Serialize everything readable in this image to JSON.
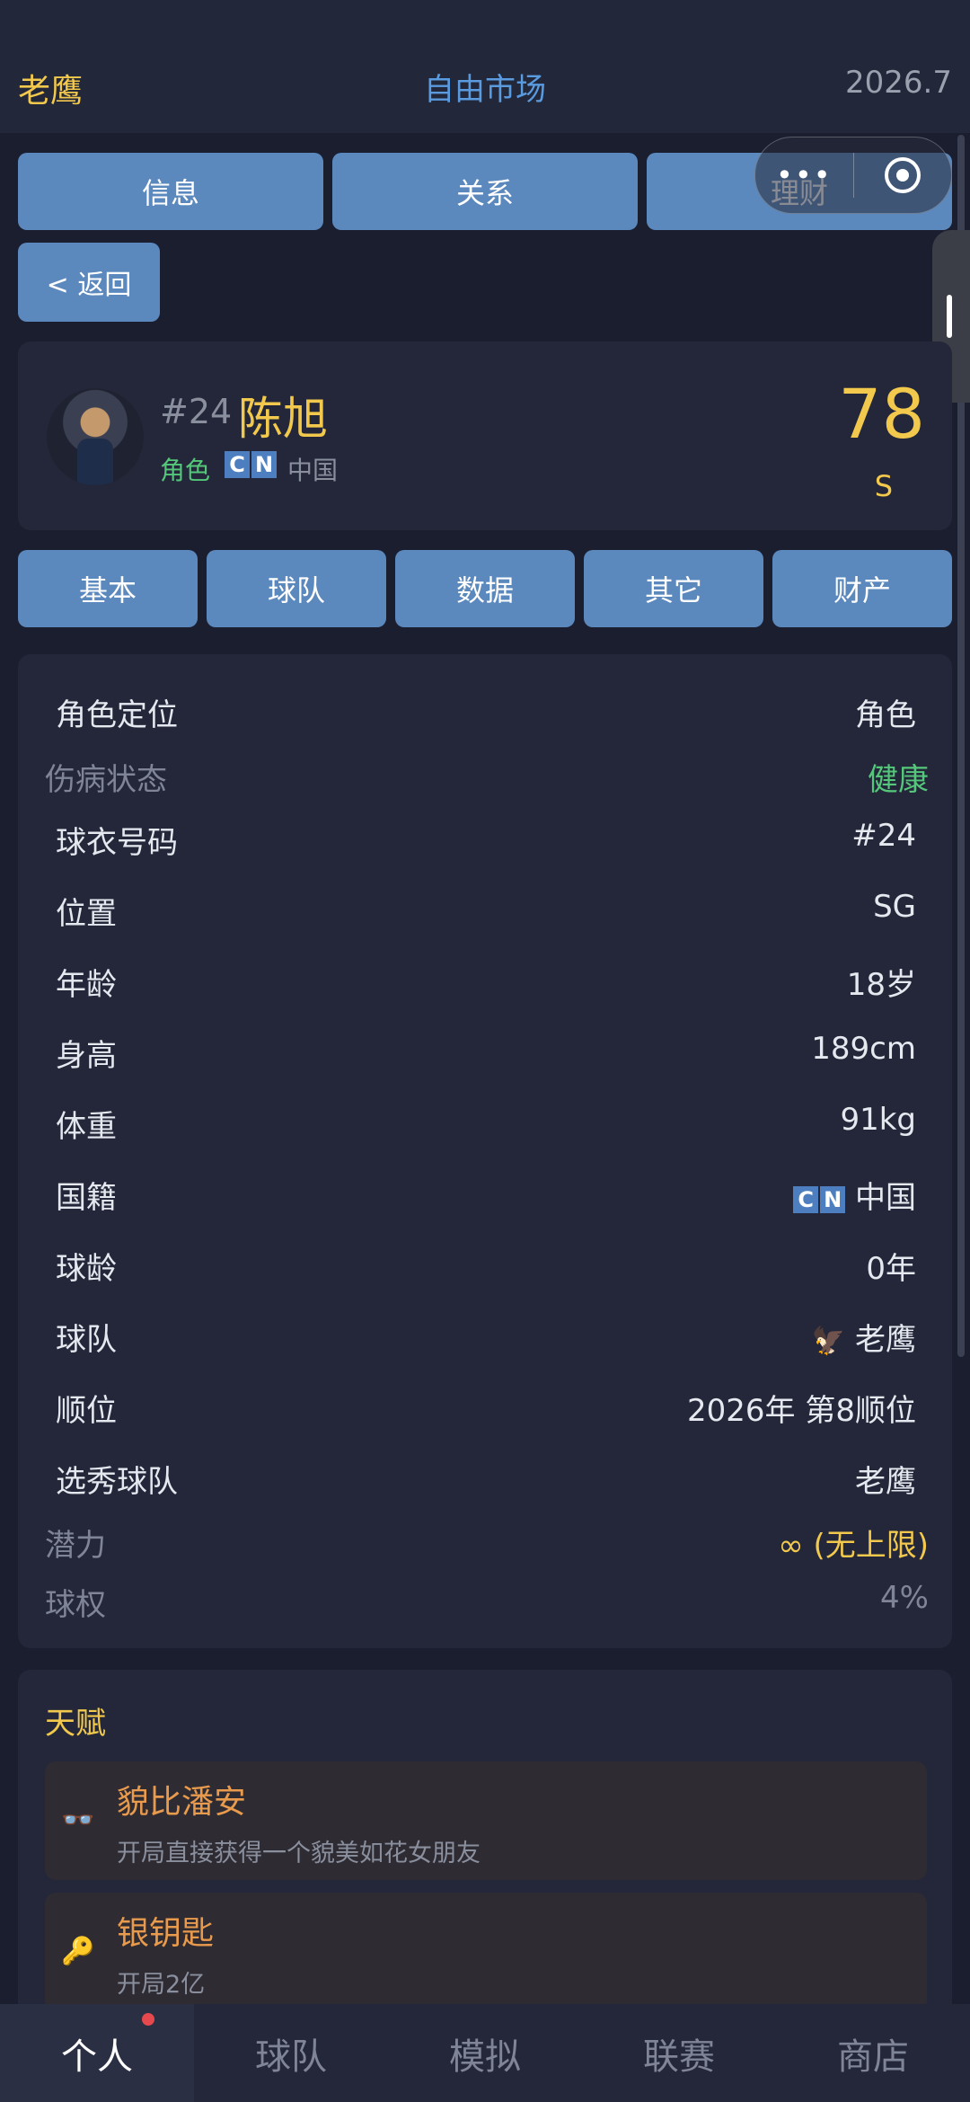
{
  "header": {
    "team": "老鹰",
    "market": "自由市场",
    "date": "2026.7"
  },
  "top_tabs": [
    "信息",
    "关系",
    "理财"
  ],
  "back_label": "< 返回",
  "player": {
    "number": "#24",
    "name": "陈旭",
    "role": "角色",
    "flag": [
      "C",
      "N"
    ],
    "country": "中国",
    "rating": "78",
    "grade": "S"
  },
  "sub_tabs": [
    "基本",
    "球队",
    "数据",
    "其它",
    "财产"
  ],
  "info": [
    {
      "label": "角色定位",
      "value": "角色"
    },
    {
      "label": "伤病状态",
      "value": "健康"
    },
    {
      "label": "球衣号码",
      "value": "#24"
    },
    {
      "label": "位置",
      "value": "SG"
    },
    {
      "label": "年龄",
      "value": "18岁"
    },
    {
      "label": "身高",
      "value": "189cm"
    },
    {
      "label": "体重",
      "value": "91kg"
    },
    {
      "label": "国籍",
      "value": "中国"
    },
    {
      "label": "球龄",
      "value": "0年"
    },
    {
      "label": "球队",
      "value": "老鹰"
    },
    {
      "label": "顺位",
      "value": "2026年 第8顺位"
    },
    {
      "label": "选秀球队",
      "value": "老鹰"
    },
    {
      "label": "潜力",
      "value": "∞ (无上限)"
    },
    {
      "label": "球权",
      "value": "4%"
    }
  ],
  "talent": {
    "title": "天赋",
    "items": [
      {
        "icon": "sunglasses-icon",
        "name": "貌比潘安",
        "desc": "开局直接获得一个貌美如花女朋友"
      },
      {
        "icon": "key-icon",
        "name": "银钥匙",
        "desc": "开局2亿"
      }
    ]
  },
  "nav": [
    "个人",
    "球队",
    "模拟",
    "联赛",
    "商店"
  ]
}
